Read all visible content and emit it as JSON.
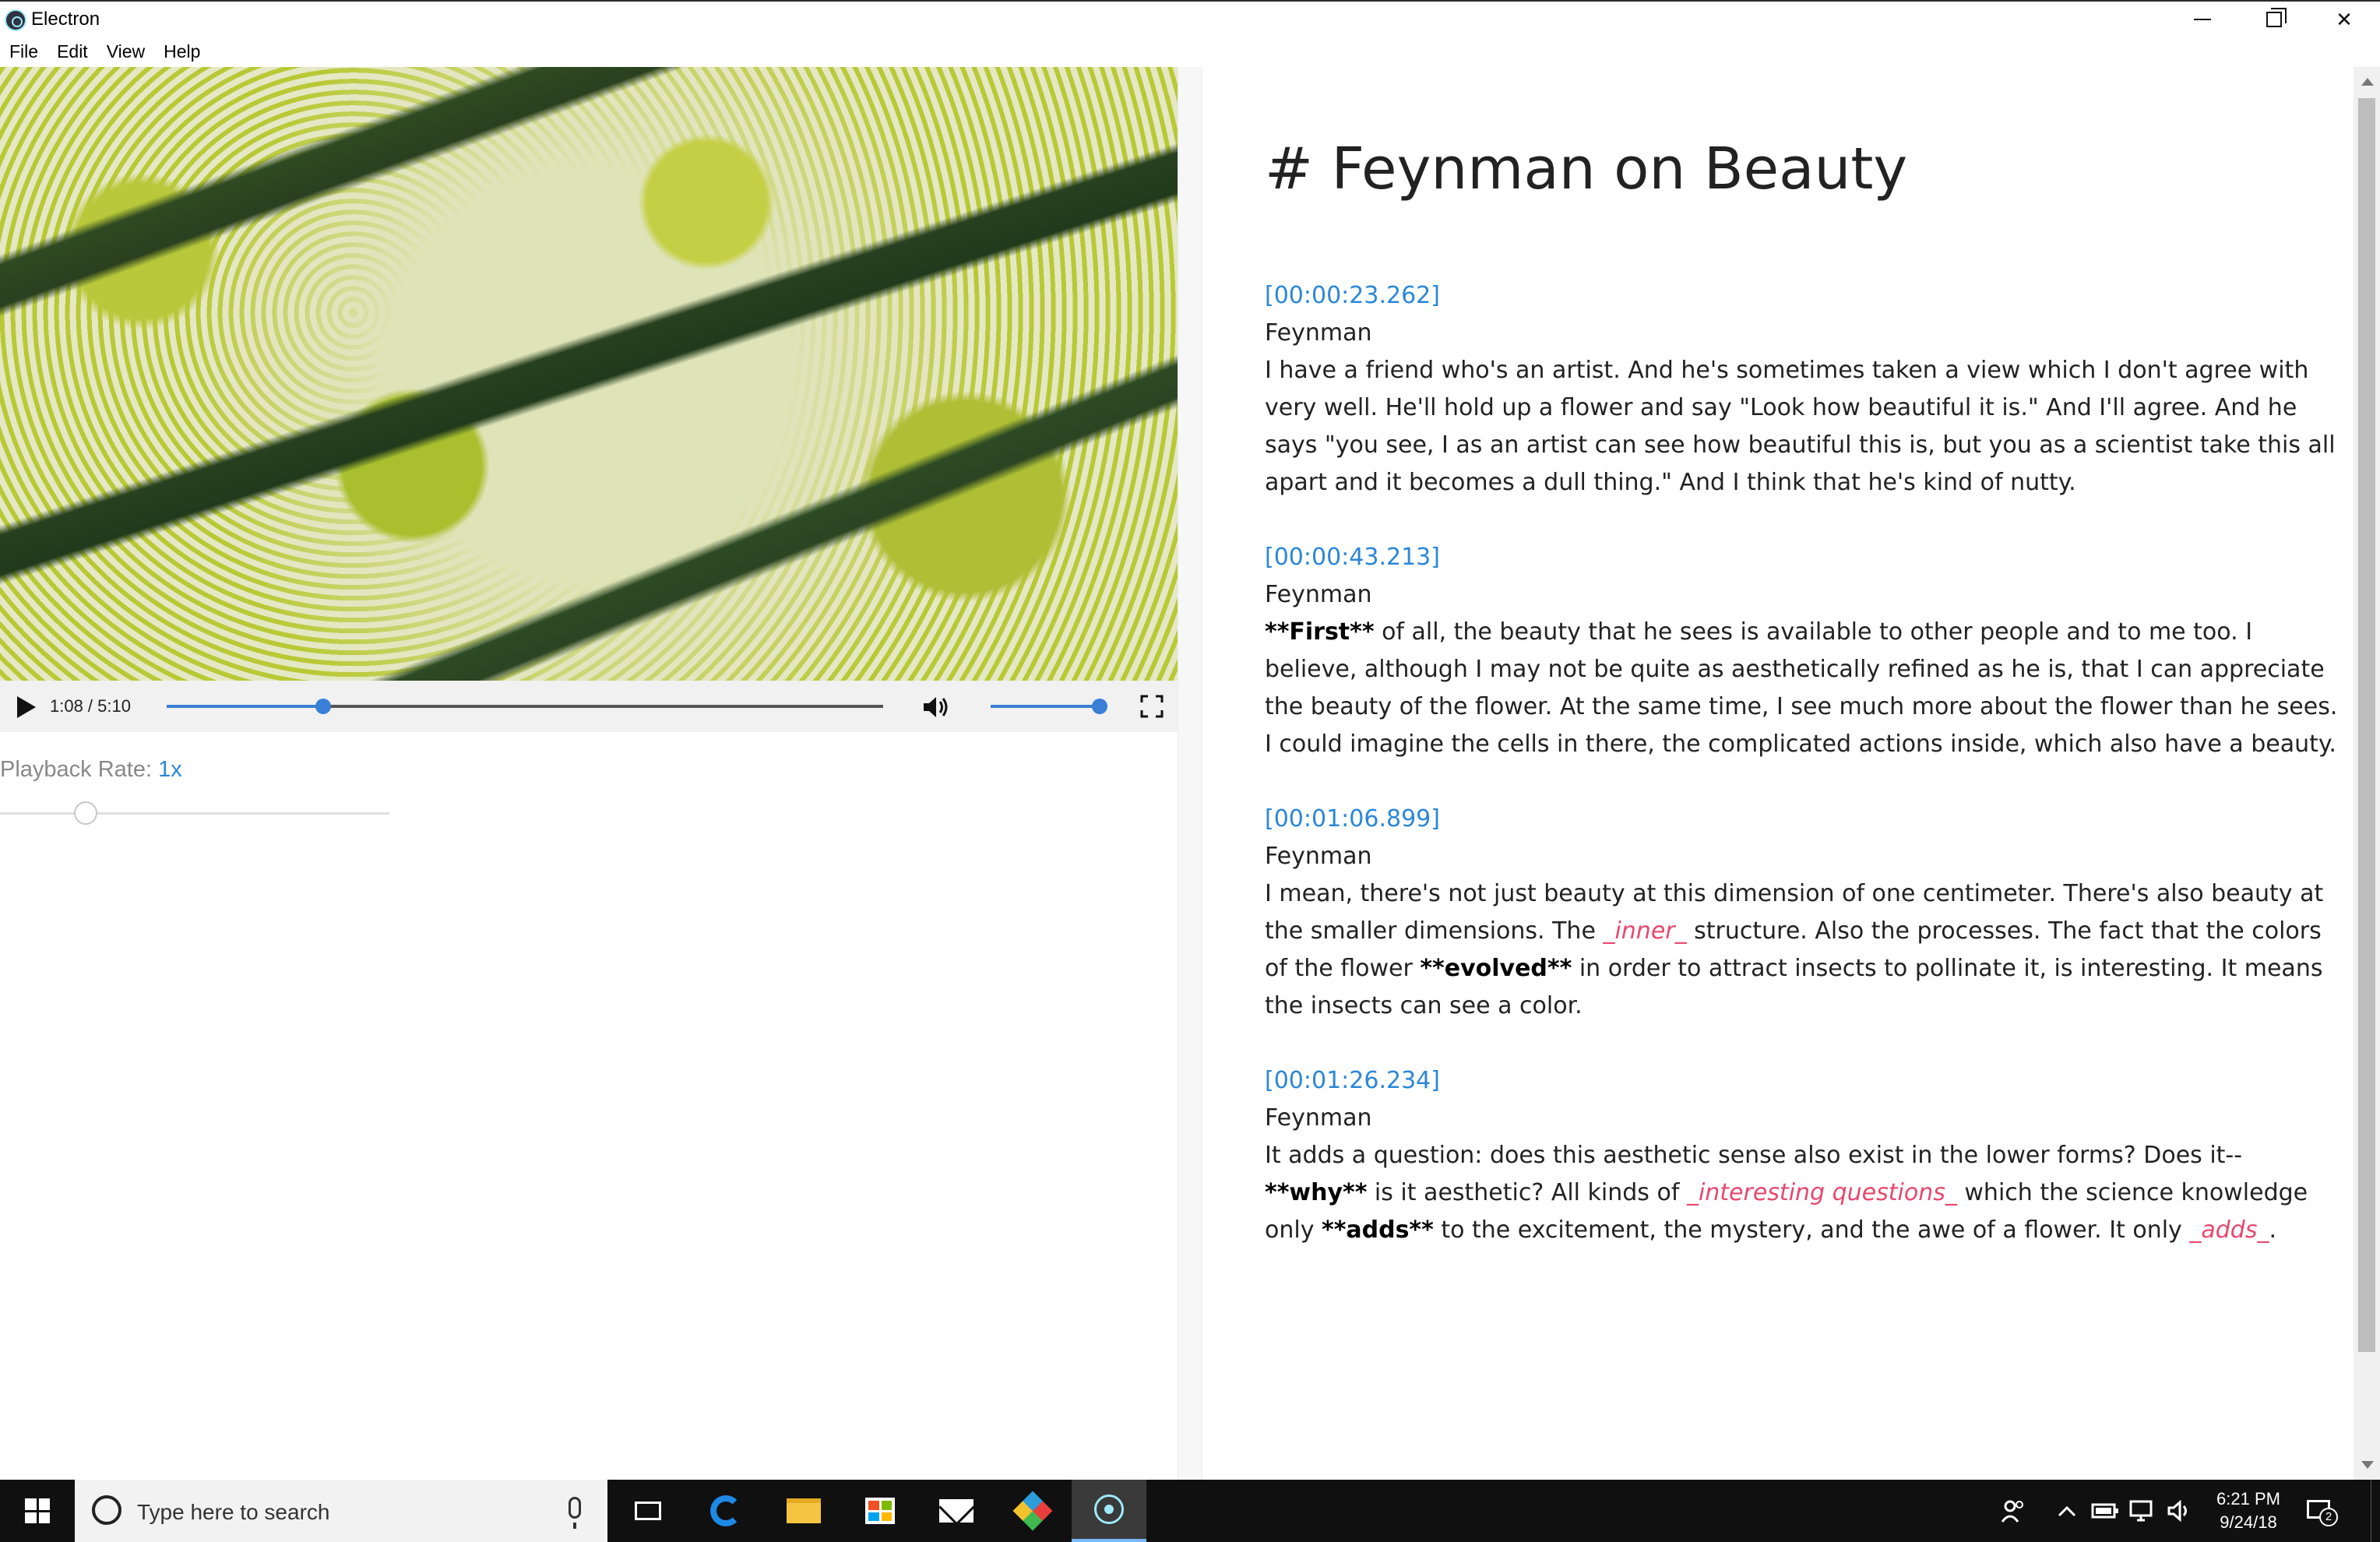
{
  "window": {
    "title": "Electron",
    "minimize_glyph": "",
    "maximize_glyph": "",
    "close_glyph": "✕"
  },
  "menu": [
    "File",
    "Edit",
    "View",
    "Help"
  ],
  "player": {
    "time": "1:08 / 5:10",
    "progress": 0.218,
    "volume": 1.0
  },
  "playback": {
    "label": "Playback Rate:",
    "value": "1x",
    "slider_position": 0.22
  },
  "document": {
    "title": "# Feynman on Beauty",
    "entries": [
      {
        "timestamp": "[00:00:23.262]",
        "speaker": "Feynman",
        "segments": [
          {
            "t": "I have a friend who's an artist. And he's sometimes taken a view which I don't agree with very well. He'll hold up a flower and say \"Look how beautiful it is.\" And I'll agree. And he says \"you see, I as an artist can see how beautiful this is, but you as a scientist take this all apart and it becomes a dull thing.\" And I think that he's kind of nutty.",
            "s": "plain"
          }
        ]
      },
      {
        "timestamp": "[00:00:43.213]",
        "speaker": "Feynman",
        "segments": [
          {
            "t": "**First**",
            "s": "bold"
          },
          {
            "t": " of all, the beauty that he sees is available to other people and to me too. I believe, although I may not be quite as aesthetically refined as he is, that I can appreciate the beauty of the flower. At the same time, I see much more about the flower than he sees. I could imagine the cells in there, the complicated actions inside, which also have a beauty.",
            "s": "plain"
          }
        ]
      },
      {
        "timestamp": "[00:01:06.899]",
        "speaker": "Feynman",
        "segments": [
          {
            "t": "I mean, there's not just beauty at this dimension of one centimeter. There's also beauty at the smaller dimensions. The ",
            "s": "plain"
          },
          {
            "t": "_inner_",
            "s": "em"
          },
          {
            "t": " structure. Also the processes. The fact that the colors of the flower ",
            "s": "plain"
          },
          {
            "t": "**evolved**",
            "s": "bold"
          },
          {
            "t": " in order to attract insects to pollinate it, is interesting. It means the insects can see a color.",
            "s": "plain"
          }
        ]
      },
      {
        "timestamp": "[00:01:26.234]",
        "speaker": "Feynman",
        "segments": [
          {
            "t": "It adds a question: does this aesthetic sense also exist in the lower forms? Does it--",
            "s": "plain"
          },
          {
            "t": "**why**",
            "s": "bold"
          },
          {
            "t": " is it aesthetic? All kinds of ",
            "s": "plain"
          },
          {
            "t": "_interesting questions_",
            "s": "em"
          },
          {
            "t": " which the science knowledge only ",
            "s": "plain"
          },
          {
            "t": "**adds**",
            "s": "bold"
          },
          {
            "t": " to the excitement, the mystery, and the awe of a flower. It only ",
            "s": "plain"
          },
          {
            "t": "_adds_",
            "s": "em"
          },
          {
            "t": ".",
            "s": "plain"
          }
        ]
      }
    ]
  },
  "taskbar": {
    "search_placeholder": "Type here to search",
    "apps": [
      "task-view",
      "edge",
      "file-explorer",
      "microsoft-store",
      "mail",
      "gitkraken",
      "electron"
    ],
    "time": "6:21 PM",
    "date": "9/24/18",
    "notification_count": "2"
  },
  "colors": {
    "accent": "#3a7fd5",
    "link": "#2b87d8",
    "emphasis": "#e8486e"
  }
}
